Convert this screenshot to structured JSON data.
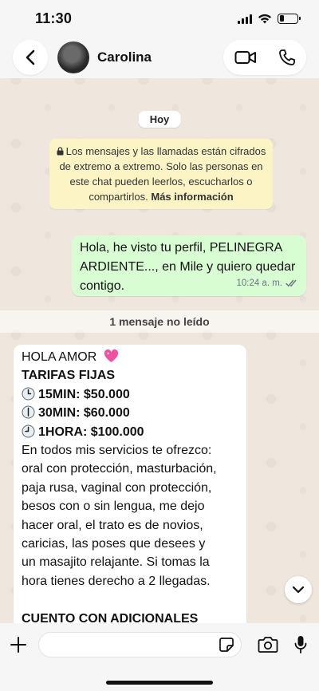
{
  "status_bar": {
    "time": "11:30",
    "battery_level": 0.25
  },
  "header": {
    "contact_name": "Carolina"
  },
  "date_chip": "Hoy",
  "e2e_notice": {
    "text": "Los mensajes y las llamadas están cifrados de extremo a extremo. Solo las personas en este chat pueden leerlos, escucharlos o compartirlos.",
    "link": "Más información"
  },
  "outgoing_message": {
    "text": "Hola, he visto tu perfil, PELINEGRA ARDIENTE..., en Mile y quiero quedar contigo.",
    "time": "10:24 a. m."
  },
  "unread_banner": "1 mensaje no leído",
  "incoming_message": {
    "greeting": "HOLA AMOR",
    "rates_title": "TARIFAS FIJAS",
    "rates": [
      {
        "icon": "clock-icon",
        "label": "15MIN: $50.000"
      },
      {
        "icon": "clock-icon",
        "label": "30MIN: $60.000"
      },
      {
        "icon": "clock-icon",
        "label": "1HORA: $100.000"
      }
    ],
    "body_lines": [
      "En todos mis servicios te ofrezco:",
      "oral con protección, masturbación,",
      "paja rusa, vaginal con protección,",
      "besos con o sin lengua, me dejo",
      "hacer oral, el trato es de novios,",
      "caricias, las poses que desees y",
      "un masajito relajante. Si tomas la",
      "hora tienes derecho a 2 llegadas."
    ],
    "extras_title": "CUENTO CON ADICIONALES"
  },
  "input": {
    "value": "",
    "placeholder": ""
  },
  "colors": {
    "outgoing_bubble": "#d9fdd3",
    "notice_bg": "#fdf4c5",
    "chat_bg": "#efe7dd"
  }
}
